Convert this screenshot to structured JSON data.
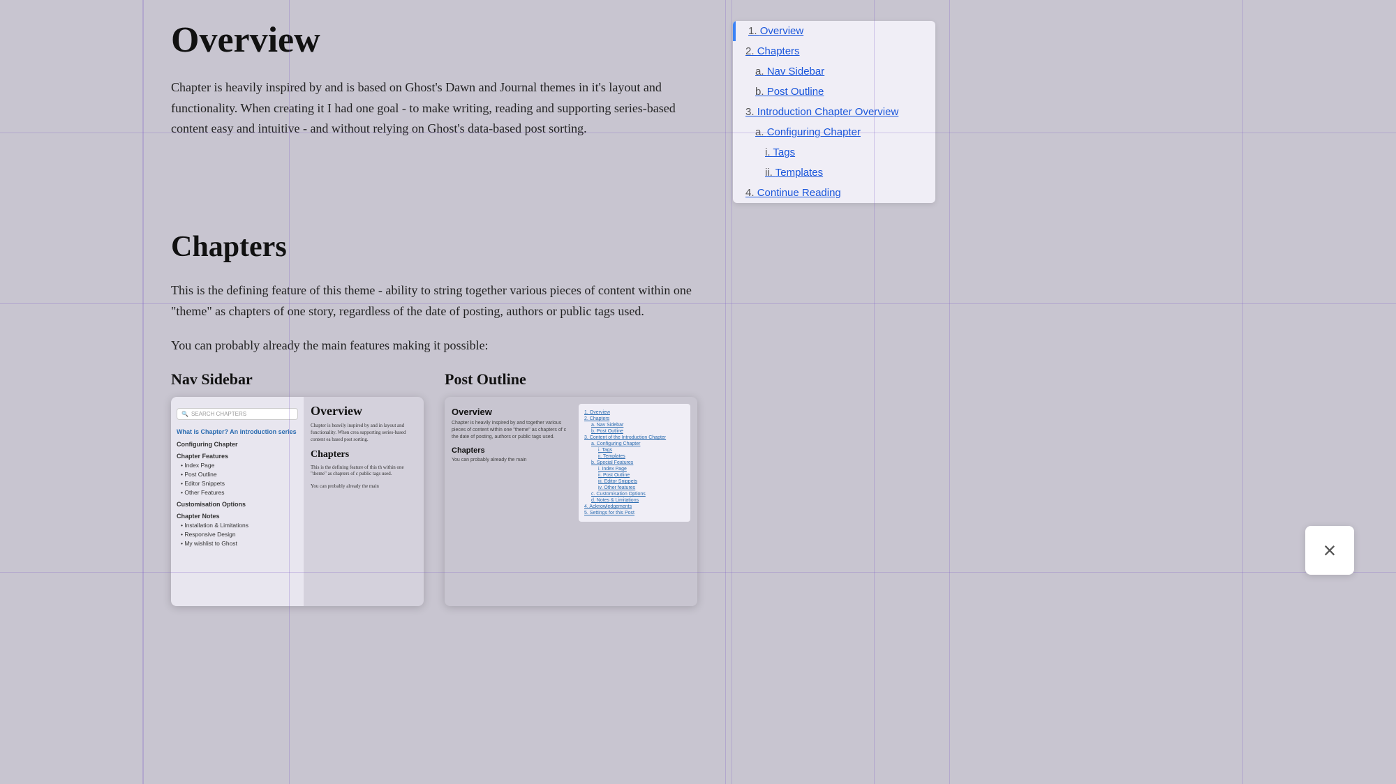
{
  "page": {
    "title": "Overview",
    "intro": "Chapter is heavily inspired by and is based on Ghost's Dawn and Journal themes in it's layout and functionality. When creating it I had one goal - to make writing, reading and supporting series-based content easy and intuitive - and without relying on Ghost's data-based post sorting.",
    "section2_title": "Chapters",
    "section2_body1": "This is the defining feature of this theme - ability to string together various pieces of content within one \"theme\" as chapters of one story, regardless of the date of posting, authors or public tags used.",
    "section2_body2": "You can probably already the main features making it possible:",
    "subsection1_title": "Nav Sidebar",
    "subsection2_title": "Post Outline",
    "close_button": "×"
  },
  "toc": {
    "items": [
      {
        "level": "1",
        "number": "1.",
        "label": "Overview",
        "active": true
      },
      {
        "level": "2",
        "number": "2.",
        "label": "Chapters"
      },
      {
        "level": "2a",
        "number": "a.",
        "label": "Nav Sidebar"
      },
      {
        "level": "2b",
        "number": "b.",
        "label": "Post Outline"
      },
      {
        "level": "3",
        "number": "3.",
        "label": "Introduction Chapter Overview"
      },
      {
        "level": "3a",
        "number": "a.",
        "label": "Configuring Chapter"
      },
      {
        "level": "3ai",
        "number": "i.",
        "label": "Tags"
      },
      {
        "level": "3aii",
        "number": "ii.",
        "label": "Templates"
      },
      {
        "level": "4",
        "number": "4.",
        "label": "Continue Reading"
      }
    ]
  },
  "nav_sidebar_preview": {
    "search_placeholder": "SEARCH CHAPTERS",
    "featured_link": "What is Chapter? An introduction series",
    "items": [
      "Configuring Chapter",
      "Chapter Features",
      "• Index Page",
      "• Post Outline",
      "• Editor Snippets",
      "• Other Features",
      "Customisation Options",
      "Chapter Notes",
      "• Installation & Limitations",
      "• Responsive Design",
      "• My wishlist to Ghost"
    ]
  },
  "post_outline_preview": {
    "outline_items": [
      {
        "level": 0,
        "label": "1. Overview"
      },
      {
        "level": 0,
        "label": "2. Chapters"
      },
      {
        "level": 1,
        "label": "a. Nav Sidebar"
      },
      {
        "level": 1,
        "label": "b. Post Outline"
      },
      {
        "level": 0,
        "label": "3. Content of the Introduction Chapter"
      },
      {
        "level": 1,
        "label": "a. Configuring Chapter"
      },
      {
        "level": 2,
        "label": "i. Tags"
      },
      {
        "level": 2,
        "label": "ii. Templates"
      },
      {
        "level": 1,
        "label": "b. Special Features"
      },
      {
        "level": 2,
        "label": "i. Index Page"
      },
      {
        "level": 2,
        "label": "ii. Post Outline"
      },
      {
        "level": 2,
        "label": "iii. Editor Snippets"
      },
      {
        "level": 2,
        "label": "iv. Other features"
      },
      {
        "level": 1,
        "label": "c. Customisation Options"
      },
      {
        "level": 1,
        "label": "d. Notes & Limitations"
      },
      {
        "level": 0,
        "label": "4. Acknowledgements"
      },
      {
        "level": 0,
        "label": "5. Settings for this Post"
      }
    ]
  }
}
